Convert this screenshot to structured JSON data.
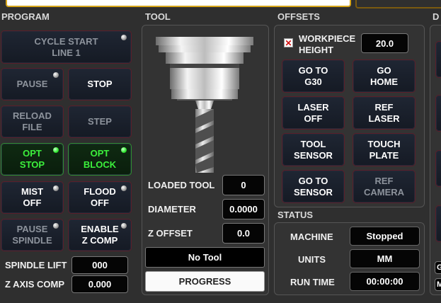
{
  "sections": {
    "program": "PROGRAM",
    "tool": "TOOL",
    "offsets": "OFFSETS",
    "status": "STATUS",
    "right_cut": "D"
  },
  "program": {
    "cycle_start": [
      "CYCLE START",
      "LINE 1"
    ],
    "pause": "PAUSE",
    "stop": "STOP",
    "reload": [
      "RELOAD",
      "FILE"
    ],
    "step": "STEP",
    "opt_stop": [
      "OPT",
      "STOP"
    ],
    "opt_block": [
      "OPT",
      "BLOCK"
    ],
    "mist": [
      "MIST",
      "OFF"
    ],
    "flood": [
      "FLOOD",
      "OFF"
    ],
    "pause_spindle": [
      "PAUSE",
      "SPINDLE"
    ],
    "enable_zcomp": [
      "ENABLE",
      "Z COMP"
    ],
    "spindle_lift_label": "SPINDLE LIFT",
    "spindle_lift_value": "000",
    "z_axis_comp_label": "Z AXIS COMP",
    "z_axis_comp_value": "0.000"
  },
  "tool": {
    "loaded_tool_label": "LOADED TOOL",
    "loaded_tool_value": "0",
    "diameter_label": "DIAMETER",
    "diameter_value": "0.0000",
    "z_offset_label": "Z OFFSET",
    "z_offset_value": "0.0",
    "tool_name": "No Tool",
    "progress_label": "PROGRESS"
  },
  "offsets": {
    "workpiece_height_label": [
      "WORKPIECE",
      "HEIGHT"
    ],
    "workpiece_height_value": "20.0",
    "go_g30": [
      "GO TO",
      "G30"
    ],
    "go_home": [
      "GO",
      "HOME"
    ],
    "laser_off": [
      "LASER",
      "OFF"
    ],
    "ref_laser": [
      "REF",
      "LASER"
    ],
    "tool_sensor": [
      "TOOL",
      "SENSOR"
    ],
    "touch_plate": [
      "TOUCH",
      "PLATE"
    ],
    "go_sensor": [
      "GO TO",
      "SENSOR"
    ],
    "ref_camera": [
      "REF",
      "CAMERA"
    ]
  },
  "status": {
    "machine_label": "MACHINE",
    "machine_value": "Stopped",
    "units_label": "UNITS",
    "units_value": "MM",
    "runtime_label": "RUN TIME",
    "runtime_value": "00:00:00"
  },
  "right_edge": {
    "letters": [
      "G",
      "M"
    ]
  }
}
